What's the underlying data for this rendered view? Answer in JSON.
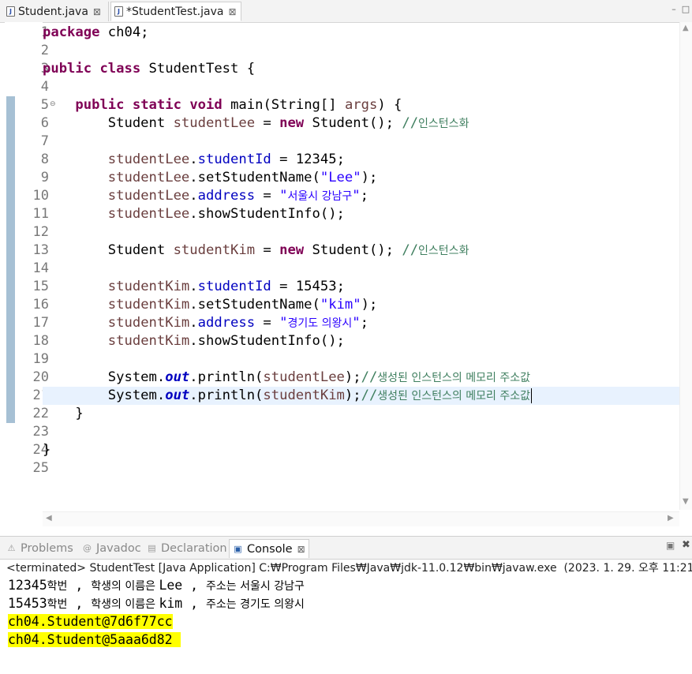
{
  "editor_tabs": [
    {
      "label": "Student.java",
      "active": false,
      "close": "⊠"
    },
    {
      "label": "*StudentTest.java",
      "active": true,
      "close": "⊠"
    }
  ],
  "editor": {
    "line_numbers": [
      "1",
      "2",
      "3",
      "4",
      "5",
      "6",
      "7",
      "8",
      "9",
      "10",
      "11",
      "12",
      "13",
      "14",
      "15",
      "16",
      "17",
      "18",
      "19",
      "20",
      "21",
      "22",
      "23",
      "24",
      "25"
    ],
    "fold_marker": "⊖",
    "lines": [
      [
        {
          "t": "package",
          "c": "kw"
        },
        {
          "t": " ch04;"
        }
      ],
      [],
      [
        {
          "t": "public",
          "c": "kw"
        },
        {
          "t": " "
        },
        {
          "t": "class",
          "c": "kw"
        },
        {
          "t": " StudentTest {"
        }
      ],
      [],
      [
        {
          "t": "    "
        },
        {
          "t": "public",
          "c": "kw"
        },
        {
          "t": " "
        },
        {
          "t": "static",
          "c": "kw"
        },
        {
          "t": " "
        },
        {
          "t": "void",
          "c": "kw"
        },
        {
          "t": " main(String[] "
        },
        {
          "t": "args",
          "c": "var"
        },
        {
          "t": ") {"
        }
      ],
      [
        {
          "t": "        Student "
        },
        {
          "t": "studentLee",
          "c": "var"
        },
        {
          "t": " = "
        },
        {
          "t": "new",
          "c": "kw"
        },
        {
          "t": " Student(); "
        },
        {
          "t": "//",
          "c": "cmt"
        },
        {
          "t": "인스턴스화",
          "c": "cmt kr"
        }
      ],
      [],
      [
        {
          "t": "        "
        },
        {
          "t": "studentLee",
          "c": "var"
        },
        {
          "t": "."
        },
        {
          "t": "studentId",
          "c": "fld"
        },
        {
          "t": " = 12345;"
        }
      ],
      [
        {
          "t": "        "
        },
        {
          "t": "studentLee",
          "c": "var"
        },
        {
          "t": ".setStudentName("
        },
        {
          "t": "\"Lee\"",
          "c": "str"
        },
        {
          "t": ");"
        }
      ],
      [
        {
          "t": "        "
        },
        {
          "t": "studentLee",
          "c": "var"
        },
        {
          "t": "."
        },
        {
          "t": "address",
          "c": "fld"
        },
        {
          "t": " = "
        },
        {
          "t": "\"",
          "c": "str"
        },
        {
          "t": "서울시 강남구",
          "c": "str kr"
        },
        {
          "t": "\"",
          "c": "str"
        },
        {
          "t": ";"
        }
      ],
      [
        {
          "t": "        "
        },
        {
          "t": "studentLee",
          "c": "var"
        },
        {
          "t": ".showStudentInfo();"
        }
      ],
      [],
      [
        {
          "t": "        Student "
        },
        {
          "t": "studentKim",
          "c": "var"
        },
        {
          "t": " = "
        },
        {
          "t": "new",
          "c": "kw"
        },
        {
          "t": " Student(); "
        },
        {
          "t": "//",
          "c": "cmt"
        },
        {
          "t": "인스턴스화",
          "c": "cmt kr"
        }
      ],
      [],
      [
        {
          "t": "        "
        },
        {
          "t": "studentKim",
          "c": "var"
        },
        {
          "t": "."
        },
        {
          "t": "studentId",
          "c": "fld"
        },
        {
          "t": " = 15453;"
        }
      ],
      [
        {
          "t": "        "
        },
        {
          "t": "studentKim",
          "c": "var"
        },
        {
          "t": ".setStudentName("
        },
        {
          "t": "\"kim\"",
          "c": "str"
        },
        {
          "t": ");"
        }
      ],
      [
        {
          "t": "        "
        },
        {
          "t": "studentKim",
          "c": "var"
        },
        {
          "t": "."
        },
        {
          "t": "address",
          "c": "fld"
        },
        {
          "t": " = "
        },
        {
          "t": "\"",
          "c": "str"
        },
        {
          "t": "경기도 의왕시",
          "c": "str kr"
        },
        {
          "t": "\"",
          "c": "str"
        },
        {
          "t": ";"
        }
      ],
      [
        {
          "t": "        "
        },
        {
          "t": "studentKim",
          "c": "var"
        },
        {
          "t": ".showStudentInfo();"
        }
      ],
      [],
      [
        {
          "t": "        System."
        },
        {
          "t": "out",
          "c": "sfld"
        },
        {
          "t": ".println("
        },
        {
          "t": "studentLee",
          "c": "var"
        },
        {
          "t": ");"
        },
        {
          "t": "//",
          "c": "cmt"
        },
        {
          "t": "생성된 인스턴스의 메모리 주소값",
          "c": "cmt kr"
        }
      ],
      [
        {
          "t": "        System."
        },
        {
          "t": "out",
          "c": "sfld"
        },
        {
          "t": ".println("
        },
        {
          "t": "studentKim",
          "c": "var"
        },
        {
          "t": ");"
        },
        {
          "t": "//",
          "c": "cmt"
        },
        {
          "t": "생성된 인스턴스의 메모리 주소값",
          "c": "cmt kr"
        }
      ],
      [
        {
          "t": "    }"
        }
      ],
      [],
      [
        {
          "t": "}"
        }
      ],
      []
    ],
    "current_line": 21
  },
  "panel_tabs": [
    {
      "label": "Problems",
      "icon": "problems-icon",
      "glyph": "⚠",
      "active": false
    },
    {
      "label": "Javadoc",
      "icon": "javadoc-icon",
      "glyph": "@",
      "active": false
    },
    {
      "label": "Declaration",
      "icon": "declaration-icon",
      "glyph": "▤",
      "active": false
    },
    {
      "label": "Console",
      "icon": "console-icon",
      "glyph": "▣",
      "active": true,
      "close": "⊠"
    }
  ],
  "console": {
    "status": "<terminated> StudentTest [Java Application] C:₩Program Files₩Java₩jdk-11.0.12₩bin₩javaw.exe  (2023. 1. 29. 오후 11:21:39)",
    "output": [
      [
        {
          "t": "12345",
          "c": "mono"
        },
        {
          "t": "학번",
          "c": "kor"
        },
        {
          "t": " , ",
          "c": "mono"
        },
        {
          "t": "학생의 이름은 ",
          "c": "kor"
        },
        {
          "t": "Lee , ",
          "c": "mono"
        },
        {
          "t": "주소는 서울시 강남구",
          "c": "kor"
        }
      ],
      [
        {
          "t": "15453",
          "c": "mono"
        },
        {
          "t": "학번",
          "c": "kor"
        },
        {
          "t": " , ",
          "c": "mono"
        },
        {
          "t": "학생의 이름은 ",
          "c": "kor"
        },
        {
          "t": "kim , ",
          "c": "mono"
        },
        {
          "t": "주소는 경기도 의왕시",
          "c": "kor"
        }
      ],
      [
        {
          "t": "ch04.Student@7d6f77cc",
          "c": "mono hl"
        }
      ],
      [
        {
          "t": "ch04.Student@5aaa6d82 ",
          "c": "mono hl"
        }
      ]
    ]
  },
  "window_buttons": {
    "minimize": "–",
    "maximize": "□"
  },
  "panel_buttons": {
    "minimize": "▣",
    "close": "✖"
  }
}
